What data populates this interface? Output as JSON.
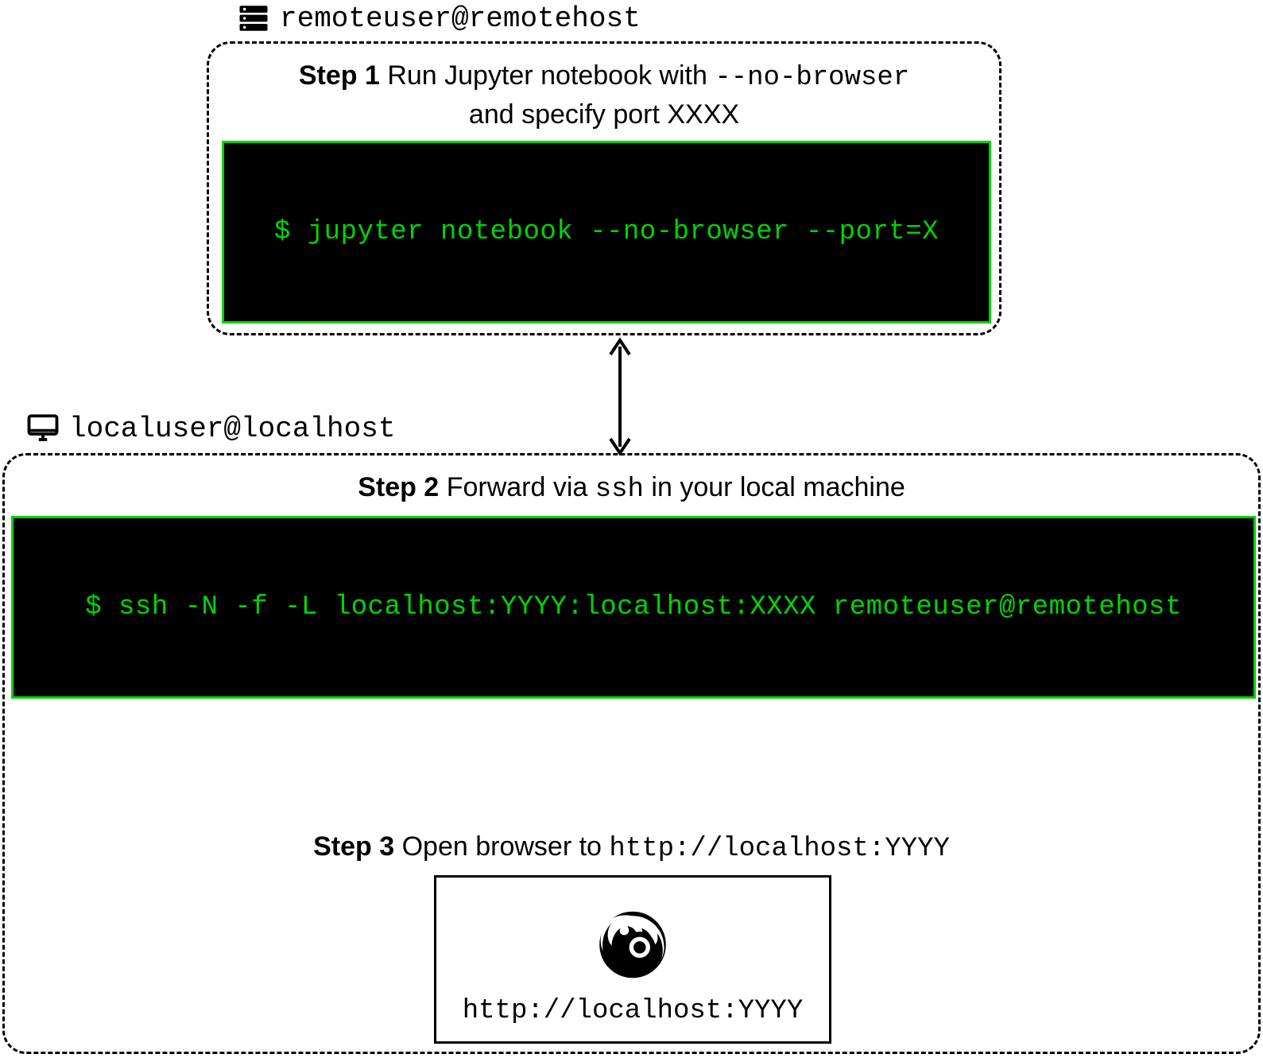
{
  "remote": {
    "host_label": "remoteuser@remotehost",
    "step1_label": "Step 1",
    "step1_text_a": "Run Jupyter notebook with",
    "step1_flag": "--no-browser",
    "step1_text_b": "and specify port XXXX",
    "terminal_cmd": "$ jupyter notebook --no-browser --port=X"
  },
  "local": {
    "host_label": "localuser@localhost",
    "step2_label": "Step 2",
    "step2_text_a": "Forward via",
    "step2_cmd_word": "ssh",
    "step2_text_b": "in your local machine",
    "terminal_cmd": "$ ssh -N -f -L localhost:YYYY:localhost:XXXX remoteuser@remotehost",
    "step3_label": "Step 3",
    "step3_text_a": "Open browser to",
    "step3_url": "http://localhost:YYYY",
    "browser_url": "http://localhost:YYYY"
  }
}
